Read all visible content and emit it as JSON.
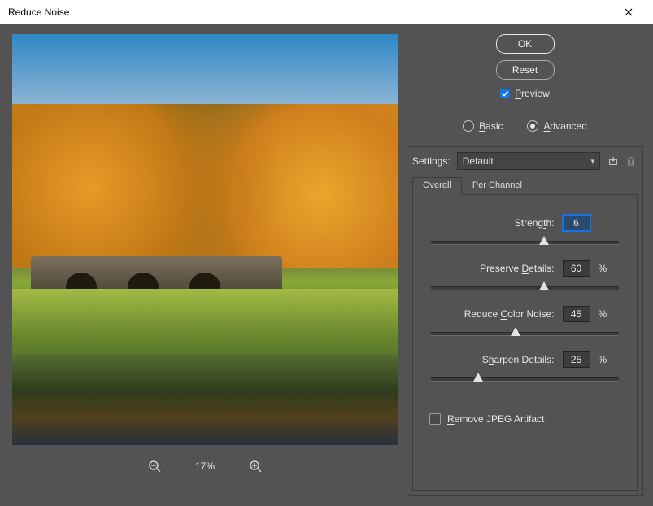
{
  "window": {
    "title": "Reduce Noise"
  },
  "buttons": {
    "ok": "OK",
    "reset": "Reset"
  },
  "preview_toggle": {
    "label": "Preview",
    "checked": true
  },
  "mode": {
    "basic_label": "Basic",
    "advanced_label": "Advanced",
    "basic_hot": "B",
    "advanced_hot": "A",
    "selected": "advanced"
  },
  "settings": {
    "label": "Settings:",
    "selected": "Default"
  },
  "tabs": {
    "overall": "Overall",
    "per_channel": "Per Channel",
    "active": "overall"
  },
  "params": {
    "strength": {
      "label": "Strength:",
      "hot": "t",
      "value": "6",
      "max": 10,
      "has_pct": false
    },
    "preserve_details": {
      "label": "Preserve Details:",
      "hot": "D",
      "value": "60",
      "max": 100,
      "has_pct": true
    },
    "reduce_color": {
      "label": "Reduce Color Noise:",
      "hot": "C",
      "value": "45",
      "max": 100,
      "has_pct": true
    },
    "sharpen_details": {
      "label": "Sharpen Details:",
      "hot": "h",
      "value": "25",
      "max": 100,
      "has_pct": true
    }
  },
  "remove_jpeg": {
    "label": "Remove JPEG Artifact",
    "hot": "R",
    "checked": false
  },
  "zoom": {
    "level": "17%"
  }
}
